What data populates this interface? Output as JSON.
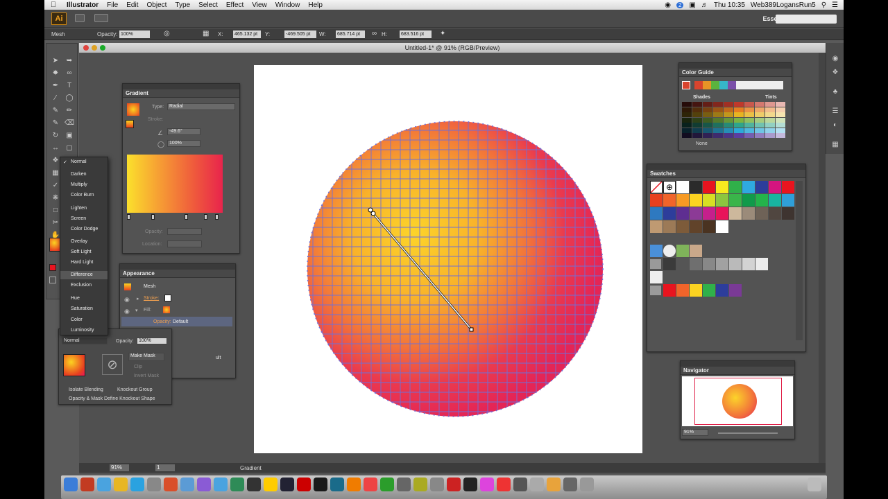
{
  "menubar": {
    "apple": "",
    "app": "Illustrator",
    "menus": [
      "File",
      "Edit",
      "Object",
      "Type",
      "Select",
      "Effect",
      "View",
      "Window",
      "Help"
    ],
    "clock": "Thu 10:35",
    "user": "Web389LogansRun5",
    "badge": "2"
  },
  "appbar": {
    "logo": "Ai",
    "workspace": "Essentials"
  },
  "controlbar": {
    "selection": "Mesh",
    "opacity_label": "Opacity:",
    "opacity": "100%",
    "x_label": "X:",
    "x": "465.132 pt",
    "y_label": "Y:",
    "y": "-469.505 pt",
    "w_label": "W:",
    "w": "685.714 pt",
    "h_label": "H:",
    "h": "683.516 pt"
  },
  "document": {
    "title": "Untitled-1* @ 91% (RGB/Preview)",
    "zoom": "91%",
    "page": "1",
    "status": "Gradient"
  },
  "gradient_panel": {
    "tab": "Gradient",
    "type_label": "Type:",
    "type": "Radial",
    "stroke_label": "Stroke:",
    "angle": "-49.6°",
    "aspect": "100%",
    "opacity_label": "Opacity:",
    "location_label": "Location:",
    "stops": [
      0,
      0.26,
      0.62,
      0.83,
      0.95
    ]
  },
  "appearance_panel": {
    "tab": "Appearance",
    "object": "Mesh",
    "stroke_label": "Stroke:",
    "fill_label": "Fill:",
    "opacity_label": "Opacity:",
    "opacity_value": "Default",
    "opacity_value2": "ult"
  },
  "blend_menu": {
    "items": [
      {
        "label": "Normal",
        "checked": true
      },
      {
        "label": "Darken"
      },
      {
        "label": "Multiply"
      },
      {
        "label": "Color Burn"
      },
      {
        "label": "Lighten"
      },
      {
        "label": "Screen"
      },
      {
        "label": "Color Dodge"
      },
      {
        "label": "Overlay"
      },
      {
        "label": "Soft Light"
      },
      {
        "label": "Hard Light"
      },
      {
        "label": "Difference",
        "hover": true
      },
      {
        "label": "Exclusion"
      },
      {
        "label": "Hue"
      },
      {
        "label": "Saturation"
      },
      {
        "label": "Color"
      },
      {
        "label": "Luminosity"
      }
    ]
  },
  "transparency_panel": {
    "mode": "Normal",
    "opacity_label": "Opacity:",
    "opacity": "100%",
    "make_mask": "Make Mask",
    "clip": "Clip",
    "invert_mask": "Invert Mask",
    "isolate": "Isolate Blending",
    "knockout": "Knockout Group",
    "define": "Opacity & Mask Define Knockout Shape"
  },
  "color_guide": {
    "tab": "Color Guide",
    "shades": "Shades",
    "tints": "Tints",
    "none": "None",
    "harmony": [
      "#d8442e",
      "#e89426",
      "#5bb33e",
      "#36b6c8",
      "#7a4fa8"
    ],
    "rows": [
      "#c0392b",
      "#e67e22",
      "#e6b422",
      "#7cb342",
      "#2ea58b",
      "#2da9d8",
      "#5b3fa0"
    ]
  },
  "swatches": {
    "tab": "Swatches",
    "colors": [
      "#ffffff",
      "#2b2b2b",
      "#e8141f",
      "#f7ea1f",
      "#30b04a",
      "#2fa9e0",
      "#2d3d9b",
      "#d4147f",
      "#e8141f",
      "#e8401f",
      "#f0642a",
      "#f79a24",
      "#fbd321",
      "#d7df23",
      "#8cc63f",
      "#3ab54a",
      "#109a4a",
      "#24b34b",
      "#18b3a0",
      "#2f9fd9",
      "#2e79c0",
      "#2d3d9b",
      "#5e2e91",
      "#8c3a96",
      "#c51f8c",
      "#e8145a",
      "#cdb89c",
      "#9b8b7a",
      "#6e6257",
      "#504640",
      "#3e3430",
      "#bf9a72",
      "#9c7a57",
      "#7d5b3a",
      "#61432a",
      "#4a3321",
      "#ffffff"
    ],
    "grays": [
      "#3b3b3b",
      "#555",
      "#6f6f6f",
      "#888",
      "#a1a1a1",
      "#bababa",
      "#d3d3d3",
      "#ececec"
    ],
    "group": [
      "#e8141f",
      "#f0642a",
      "#fbd321",
      "#30b04a",
      "#2d3d9b",
      "#7a3a96"
    ]
  },
  "navigator": {
    "tab": "Navigator",
    "zoom": "91%"
  }
}
